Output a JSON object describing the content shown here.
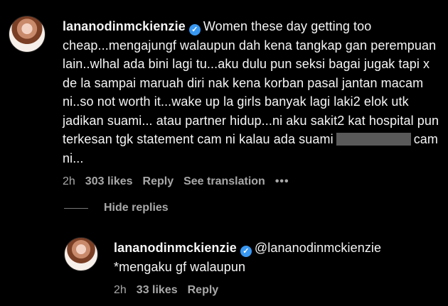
{
  "comment1": {
    "username": "lananodinmckienzie",
    "verified_icon": "verified-badge-icon",
    "text_before": "Women these day getting too cheap...mengajungf walaupun dah kena tangkap gan perempuan lain..wlhal ada bini lagi tu...aku dulu pun seksi bagai jugak tapi x de la sampai maruah diri nak kena korban pasal jantan macam ni..so not worth it...wake up la girls banyak lagi laki2 elok utk jadikan suami... atau partner hidup...ni aku sakit2 kat hospital pun terkesan tgk statement cam ni kalau ada suami",
    "text_after": "cam ni...",
    "time": "2h",
    "likes": "303 likes",
    "reply": "Reply",
    "see_translation": "See translation",
    "more": "•••"
  },
  "hide_replies": "Hide replies",
  "reply1": {
    "username": "lananodinmckienzie",
    "verified_icon": "verified-badge-icon",
    "mention": "@lananodinmckienzie",
    "text": "*mengaku gf walaupun",
    "time": "2h",
    "likes": "33 likes",
    "reply": "Reply"
  },
  "colors": {
    "background": "#000000",
    "text": "#f5f5f5",
    "secondary": "#a8a8a8",
    "verified": "#3897f0",
    "redaction": "#595959"
  }
}
